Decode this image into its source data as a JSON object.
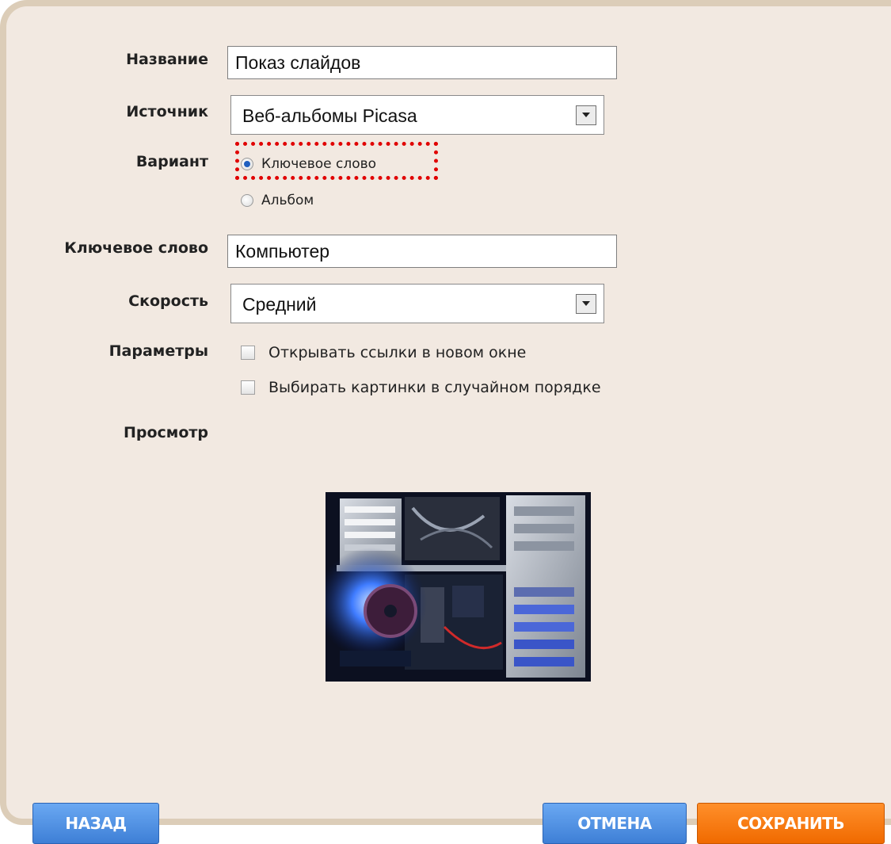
{
  "form": {
    "name_label": "Название",
    "name_value": "Показ слайдов",
    "source_label": "Источник",
    "source_value": "Веб-альбомы Picasa",
    "variant_label": "Вариант",
    "variant_options": [
      {
        "label": "Ключевое слово",
        "checked": true
      },
      {
        "label": "Альбом",
        "checked": false
      }
    ],
    "keyword_label": "Ключевое слово",
    "keyword_value": "Компьютер",
    "speed_label": "Скорость",
    "speed_value": "Средний",
    "params_label": "Параметры",
    "params_options": [
      {
        "label": "Открывать ссылки в новом окне",
        "checked": false
      },
      {
        "label": "Выбирать картинки в случайном порядке",
        "checked": false
      }
    ],
    "preview_label": "Просмотр"
  },
  "buttons": {
    "back": "НАЗАД",
    "cancel": "ОТМЕНА",
    "save": "СОХРАНИТЬ"
  },
  "colors": {
    "panel_bg": "#f2e9e1",
    "panel_border": "#dccdb8",
    "blue_button": "#4a8de0",
    "orange_button": "#f77a10",
    "highlight": "#e00000"
  }
}
